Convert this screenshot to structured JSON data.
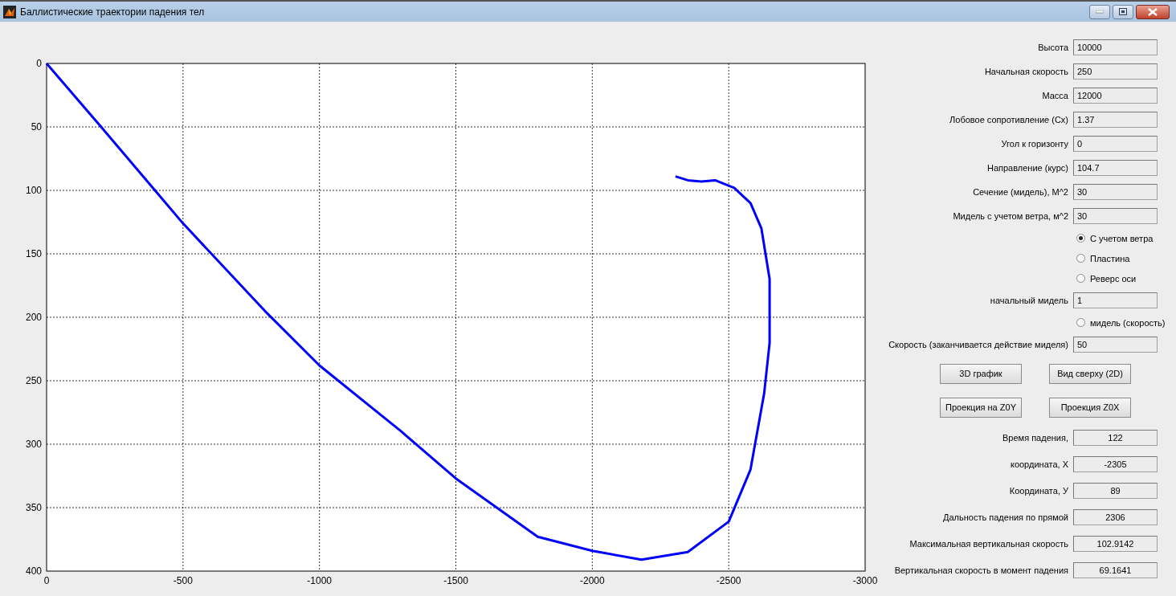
{
  "window": {
    "title": "Баллистические траектории падения тел"
  },
  "plot": {
    "chart_data": {
      "type": "line",
      "x": [
        0,
        -200,
        -500,
        -800,
        -1000,
        -1300,
        -1500,
        -1800,
        -2000,
        -2180,
        -2350,
        -2500,
        -2580,
        -2630,
        -2650,
        -2650,
        -2620,
        -2580,
        -2520,
        -2450,
        -2400,
        -2350,
        -2305
      ],
      "grid": true,
      "series": [
        {
          "color": "#0000ff",
          "values": [
            0,
            50,
            126,
            195,
            238,
            290,
            327,
            373,
            384,
            391,
            385,
            361,
            320,
            260,
            220,
            170,
            130,
            110,
            98,
            92,
            93,
            92,
            89
          ]
        }
      ],
      "xlim": [
        0,
        -3000
      ],
      "ylim": [
        400,
        0
      ],
      "xticks": [
        0,
        -500,
        -1000,
        -1500,
        -2000,
        -2500,
        -3000
      ],
      "yticks": [
        0,
        50,
        100,
        150,
        200,
        250,
        300,
        350,
        400
      ]
    }
  },
  "controls": [
    {
      "kind": "field",
      "label": "Высота",
      "value": "10000"
    },
    {
      "kind": "field",
      "label": "Начальная скорость",
      "value": "250"
    },
    {
      "kind": "field",
      "label": "Масса",
      "value": "12000"
    },
    {
      "kind": "field",
      "label": "Лобовое сопротивление (Cx)",
      "value": "1.37"
    },
    {
      "kind": "field",
      "label": "Угол к горизонту",
      "value": "0"
    },
    {
      "kind": "field",
      "label": "Направление  (курс)",
      "value": "104.7"
    },
    {
      "kind": "field",
      "label": "Сечение (мидель), М^2",
      "value": "30"
    },
    {
      "kind": "field",
      "label": "Мидель с учетом ветра, м^2",
      "value": "30"
    },
    {
      "kind": "radio",
      "label": "С учетом ветра",
      "selected": true
    },
    {
      "kind": "radio",
      "label": "Пластина",
      "selected": false
    },
    {
      "kind": "radio",
      "label": "Реверс оси",
      "selected": false
    },
    {
      "kind": "field",
      "label": "начальный мидель",
      "value": "1"
    },
    {
      "kind": "radio",
      "label": "мидель (скорость)",
      "selected": false
    },
    {
      "kind": "field",
      "label": "Скорость (заканчивается действие миделя)",
      "value": "50"
    },
    {
      "kind": "buttons",
      "buttons": [
        "3D график",
        "Вид сверху (2D)"
      ]
    },
    {
      "kind": "buttons",
      "buttons": [
        "Проекция на Z0Y",
        "Проекция Z0X"
      ]
    },
    {
      "kind": "result",
      "label": "Время падения,",
      "value": "122"
    },
    {
      "kind": "result",
      "label": "координата, X",
      "value": "-2305"
    },
    {
      "kind": "result",
      "label": "Координата, У",
      "value": "89"
    },
    {
      "kind": "result",
      "label": "Дальность падения по прямой",
      "value": "2306"
    },
    {
      "kind": "result",
      "label": "Максимальная вертикальная скорость",
      "value": "102.9142"
    },
    {
      "kind": "result",
      "label": "Вертикальная  скорость в момент падения",
      "value": "69.1641"
    }
  ]
}
